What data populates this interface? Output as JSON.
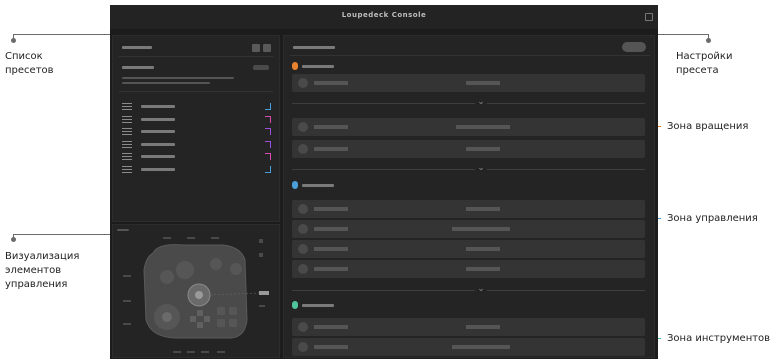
{
  "annotations": {
    "preset_list": "Список\nпресетов",
    "visualization": "Визуализация\nэлементов\nуправления",
    "preset_settings": "Настройки\nпресета",
    "rotation_zone": "Зона вращения",
    "control_zone": "Зона управления",
    "tools_zone": "Зона инструментов"
  },
  "window": {
    "title": "Loupedeck Console"
  },
  "colors": {
    "accent_orange": "#e8822e",
    "accent_blue": "#4a9fd8",
    "accent_green": "#4fc49a",
    "accent_purple": "#9b4fd6",
    "accent_pink": "#d64fb0"
  },
  "preset_list": {
    "item_identifier_colors": [
      "#4a9fd8",
      "#d64fb0",
      "#9b4fd6",
      "#9b4fd6",
      "#d64fb0",
      "#4a9fd8"
    ]
  },
  "icons": {
    "collapse_chevron": "⌄",
    "window_button": "square-icon"
  }
}
